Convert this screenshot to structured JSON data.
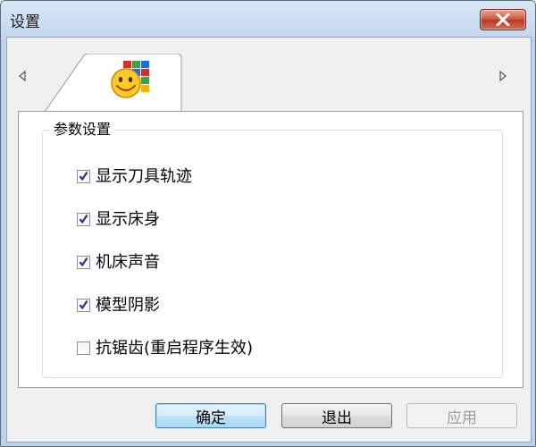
{
  "window": {
    "title": "设置"
  },
  "tabs": [
    {
      "icon": "smiley-settings-icon",
      "selected": true
    }
  ],
  "group": {
    "legend": "参数设置",
    "options": [
      {
        "label": "显示刀具轨迹",
        "checked": true
      },
      {
        "label": "显示床身",
        "checked": true
      },
      {
        "label": "机床声音",
        "checked": true
      },
      {
        "label": "模型阴影",
        "checked": true
      },
      {
        "label": "抗锯齿(重启程序生效)",
        "checked": false
      }
    ]
  },
  "buttons": {
    "ok": "确定",
    "exit": "退出",
    "apply": "应用"
  },
  "colors": {
    "titlebar": "#c2d7ee",
    "close_button": "#c9543e",
    "default_button": "#bde4f8",
    "check_mark": "#1f3f80"
  }
}
